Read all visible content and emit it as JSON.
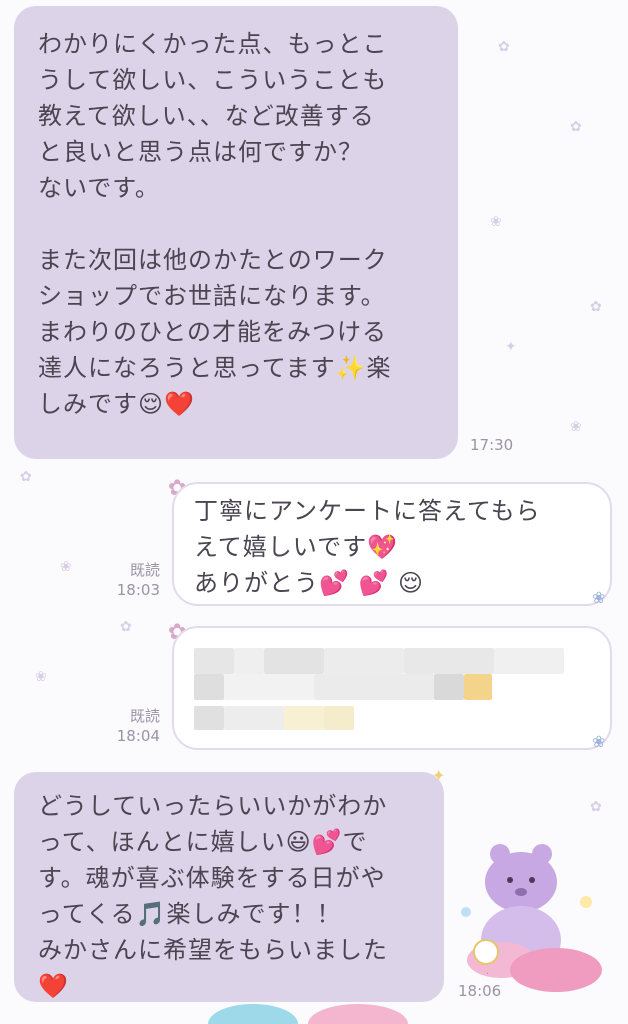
{
  "messages": {
    "first": {
      "lines": [
        "わかりにくかった点、もっとこ",
        "うして欲しい、こういうことも",
        "教えて欲しい、、など改善する",
        "と良いと思う点は何ですか？",
        "ないです。",
        "",
        "また次回は他のかたとのワーク",
        "ショップでお世話になります。",
        "まわりのひとの才能をみつける",
        "達人になろうと思ってます✨楽",
        "しみです😌❤️"
      ],
      "time": "17:30"
    },
    "second": {
      "lines": [
        "丁寧にアンケートに答えてもら",
        "えて嬉しいです💖",
        "ありがとう💕 💕 😌"
      ],
      "read": "既読",
      "time": "18:03"
    },
    "third": {
      "read": "既読",
      "time": "18:04"
    },
    "fourth": {
      "lines": [
        "どうしていったらいいかがわか",
        "って、ほんとに嬉しい😃💕で",
        "す。魂が喜ぶ体験をする日がや",
        "ってくる🎵楽しみです！！",
        "みかさんに希望をもらいました",
        "❤️"
      ],
      "time": "18:06"
    }
  },
  "colors": {
    "incoming_bubble": "#dcd3e9",
    "outgoing_bubble": "#ffffff",
    "background": "#fbfbfd"
  }
}
